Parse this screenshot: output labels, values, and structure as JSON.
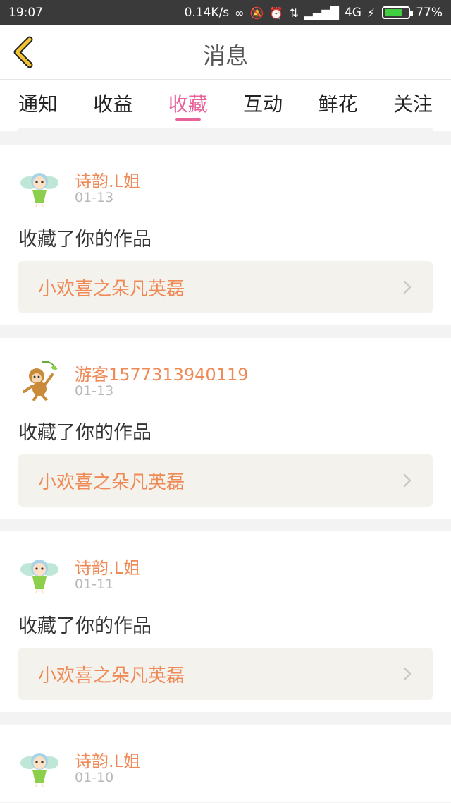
{
  "status_bar": {
    "time": "19:07",
    "speed": "0.14K/s",
    "network": "4G",
    "battery": "77%",
    "battery_level": 0.77
  },
  "header": {
    "title": "消息",
    "back_icon": "chevron-left-icon"
  },
  "tabs": [
    {
      "label": "通知",
      "active": false
    },
    {
      "label": "收益",
      "active": false
    },
    {
      "label": "收藏",
      "active": true
    },
    {
      "label": "互动",
      "active": false
    },
    {
      "label": "鲜花",
      "active": false
    },
    {
      "label": "关注",
      "active": false
    }
  ],
  "colors": {
    "accent": "#e8629a",
    "username": "#ef8a57",
    "work_title": "#ef8a57",
    "work_box_bg": "#f4f2ec"
  },
  "items": [
    {
      "user": "诗韵.L姐",
      "date": "01-13",
      "action": "收藏了你的作品",
      "work": "小欢喜之朵凡英磊",
      "avatar": "fairy-avatar"
    },
    {
      "user": "游客1577313940119",
      "date": "01-13",
      "action": "收藏了你的作品",
      "work": "小欢喜之朵凡英磊",
      "avatar": "monkey-avatar"
    },
    {
      "user": "诗韵.L姐",
      "date": "01-11",
      "action": "收藏了你的作品",
      "work": "小欢喜之朵凡英磊",
      "avatar": "fairy-avatar"
    },
    {
      "user": "诗韵.L姐",
      "date": "01-10",
      "avatar": "fairy-avatar"
    }
  ]
}
